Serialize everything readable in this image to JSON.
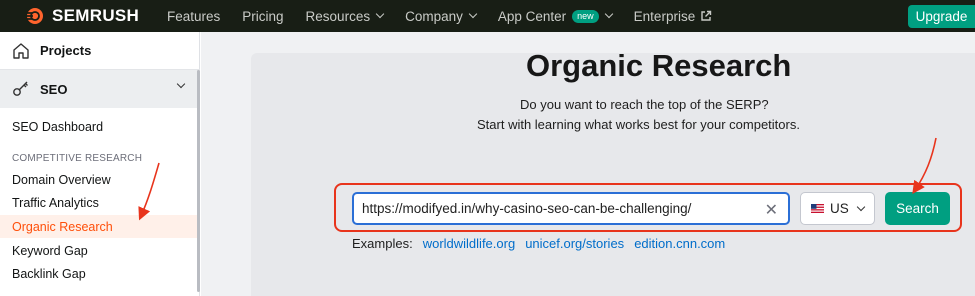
{
  "brand": {
    "name": "SEMRUSH",
    "accent": "#ff642d",
    "green": "#009f81"
  },
  "nav": {
    "items": [
      {
        "label": "Features",
        "dropdown": false
      },
      {
        "label": "Pricing",
        "dropdown": false
      },
      {
        "label": "Resources",
        "dropdown": true
      },
      {
        "label": "Company",
        "dropdown": true
      },
      {
        "label": "App Center",
        "badge": "new",
        "dropdown": true
      },
      {
        "label": "Enterprise",
        "external": true
      }
    ],
    "upgrade_label": "Upgrade"
  },
  "sidebar": {
    "projects_label": "Projects",
    "seo_label": "SEO",
    "dashboard_label": "SEO Dashboard",
    "section_label": "COMPETITIVE RESEARCH",
    "items": [
      {
        "label": "Domain Overview",
        "active": false
      },
      {
        "label": "Traffic Analytics",
        "active": false
      },
      {
        "label": "Organic Research",
        "active": true
      },
      {
        "label": "Keyword Gap",
        "active": false
      },
      {
        "label": "Backlink Gap",
        "active": false
      }
    ]
  },
  "main": {
    "title": "Organic Research",
    "subtitle_line1": "Do you want to reach the top of the SERP?",
    "subtitle_line2": "Start with learning what works best for your competitors.",
    "url_value": "https://modifyed.in/why-casino-seo-can-be-challenging/",
    "country": "US",
    "search_label": "Search",
    "examples_label": "Examples:",
    "examples": [
      "worldwildlife.org",
      "unicef.org/stories",
      "edition.cnn.com"
    ]
  },
  "annotations": {
    "color": "#e8341c"
  }
}
